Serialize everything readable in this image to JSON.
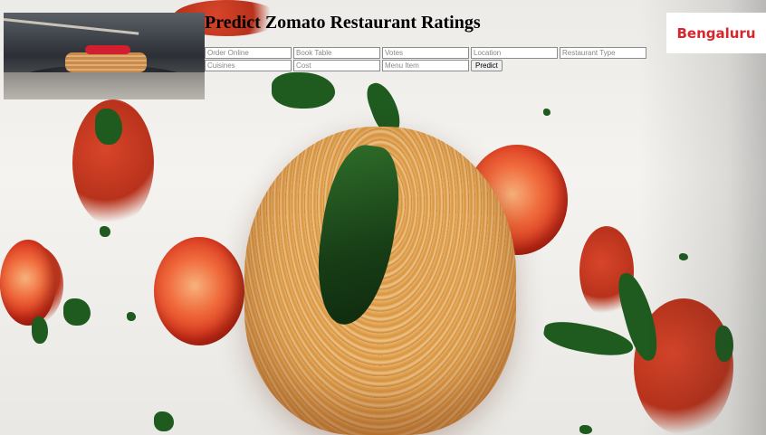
{
  "header": {
    "title": "Predict Zomato Restaurant Ratings",
    "logo_text": "Bengaluru"
  },
  "form": {
    "fields": {
      "order_online": {
        "placeholder": "Order Online",
        "value": ""
      },
      "book_table": {
        "placeholder": "Book Table",
        "value": ""
      },
      "votes": {
        "placeholder": "Votes",
        "value": ""
      },
      "location": {
        "placeholder": "Location",
        "value": ""
      },
      "restaurant_type": {
        "placeholder": "Restaurant Type",
        "value": ""
      },
      "cuisines": {
        "placeholder": "Cuisines",
        "value": ""
      },
      "cost": {
        "placeholder": "Cost",
        "value": ""
      },
      "menu_item": {
        "placeholder": "Menu Item",
        "value": ""
      }
    },
    "submit_label": "Predict"
  },
  "colors": {
    "logo_red": "#d9262d",
    "title": "#000000"
  }
}
